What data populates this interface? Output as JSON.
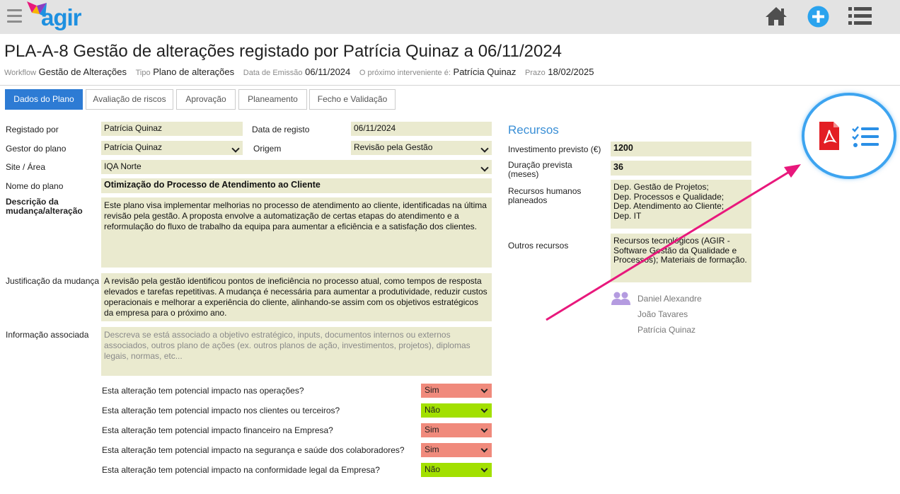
{
  "app": {
    "logo_text": "agir"
  },
  "header": {
    "title": "PLA-A-8 Gestão de alterações registado por Patrícia Quinaz a 06/11/2024",
    "workflow_label": "Workflow",
    "workflow_value": "Gestão de Alterações",
    "tipo_label": "Tipo",
    "tipo_value": "Plano de alterações",
    "emissao_label": "Data de Emissão",
    "emissao_value": "06/11/2024",
    "interveniente_label": "O próximo interveniente é:",
    "interveniente_value": "Patrícia Quinaz",
    "prazo_label": "Prazo",
    "prazo_value": "18/02/2025"
  },
  "tabs": [
    {
      "label": "Dados do Plano",
      "active": true
    },
    {
      "label": "Avaliação de riscos"
    },
    {
      "label": "Aprovação"
    },
    {
      "label": "Planeamento"
    },
    {
      "label": "Fecho e Validação"
    }
  ],
  "form": {
    "registado_por_label": "Registado por",
    "registado_por_value": "Patrícia Quinaz",
    "data_registo_label": "Data de registo",
    "data_registo_value": "06/11/2024",
    "gestor_label": "Gestor do plano",
    "gestor_value": "Patrícia Quinaz",
    "origem_label": "Origem",
    "origem_value": "Revisão pela Gestão",
    "site_label": "Site / Área",
    "site_value": "IQA Norte",
    "nome_label": "Nome do plano",
    "nome_value": "Otimização do Processo de Atendimento ao Cliente",
    "descricao_label": "Descrição da mudança/alteração",
    "descricao_value": "Este plano visa implementar melhorias no processo de atendimento ao cliente, identificadas na última revisão pela gestão. A proposta envolve a automatização de certas etapas do atendimento e a reformulação do fluxo de trabalho da equipa para aumentar a eficiência e a satisfação dos clientes.",
    "justificacao_label": "Justificação da mudança",
    "justificacao_value": "A revisão pela gestão identificou pontos de ineficiência no processo atual, como tempos de resposta elevados e tarefas repetitivas. A mudança é necessária para aumentar a produtividade, reduzir custos operacionais e melhorar a experiência do cliente, alinhando-se assim com os objetivos estratégicos da empresa para o próximo ano.",
    "info_label": "Informação associada",
    "info_placeholder": "Descreva se está associado a objetivo estratégico, inputs, documentos internos ou externos associados, outros plano de ações (ex. outros planos de ação, investimentos, projetos), diplomas legais, normas, etc..."
  },
  "questions": [
    {
      "label": "Esta alteração tem potencial impacto nas operações?",
      "value": "Sim"
    },
    {
      "label": "Esta alteração tem potencial impacto nos clientes ou terceiros?",
      "value": "Não"
    },
    {
      "label": "Esta alteração tem potencial impacto financeiro na Empresa?",
      "value": "Sim"
    },
    {
      "label": "Esta alteração tem potencial impacto na segurança e saúde dos colaboradores?",
      "value": "Sim"
    },
    {
      "label": "Esta alteração tem potencial impacto na conformidade legal da Empresa?",
      "value": "Não"
    }
  ],
  "recursos": {
    "title": "Recursos",
    "investimento_label": "Investimento previsto (€)",
    "investimento_value": "1200",
    "duracao_label": "Duração prevista (meses)",
    "duracao_value": "36",
    "humanos_label": "Recursos humanos planeados",
    "humanos_lines": [
      "Dep. Gestão de Projetos;",
      "Dep. Processos e Qualidade;",
      "Dep. Atendimento ao Cliente;",
      "Dep. IT"
    ],
    "outros_label": "Outros recursos",
    "outros_value": "Recursos tecnológicos (AGIR - Software Gestão da Qualidade e Processos); Materiais de formação."
  },
  "people": [
    "Daniel Alexandre",
    "João Tavares",
    "Patrícia Quinaz"
  ],
  "icons": {
    "menu": "hamburger-icon",
    "home": "home-icon",
    "add": "add-icon",
    "list": "list-icon",
    "pdf": "pdf-icon",
    "checklist": "checklist-icon",
    "people": "people-icon"
  },
  "colors": {
    "accent": "#2d7bd4",
    "field_bg": "#eaeacf",
    "yes": "#f08a7c",
    "no": "#a2e000",
    "highlight": "#3da4f0",
    "arrow": "#e8187c",
    "pdf": "#e31e24"
  }
}
